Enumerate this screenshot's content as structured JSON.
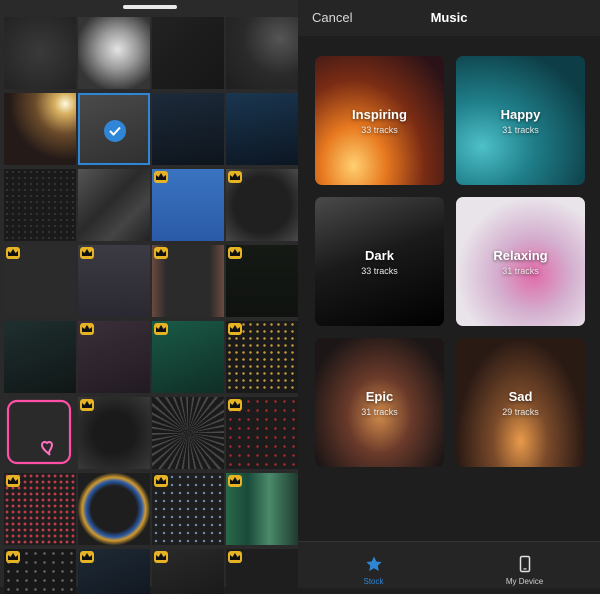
{
  "header": {
    "cancel_label": "Cancel",
    "title": "Music"
  },
  "categories": [
    {
      "name": "Inspiring",
      "tracks": "33 tracks"
    },
    {
      "name": "Happy",
      "tracks": "31 tracks"
    },
    {
      "name": "Dark",
      "tracks": "33 tracks"
    },
    {
      "name": "Relaxing",
      "tracks": "31 tracks"
    },
    {
      "name": "Epic",
      "tracks": "31 tracks"
    },
    {
      "name": "Sad",
      "tracks": "29 tracks"
    }
  ],
  "tabs": [
    {
      "label": "Stock",
      "icon": "star-icon",
      "active": true
    },
    {
      "label": "My Device",
      "icon": "phone-icon",
      "active": false
    }
  ],
  "colors": {
    "accent": "#2f86d6",
    "premium": "#e5b323"
  },
  "overlays": {
    "selected_index": 5,
    "premium_indices": [
      10,
      11,
      12,
      13,
      14,
      15,
      17,
      18,
      19,
      21,
      23,
      24,
      26,
      27,
      28,
      29,
      30,
      31,
      33,
      34,
      35
    ]
  }
}
